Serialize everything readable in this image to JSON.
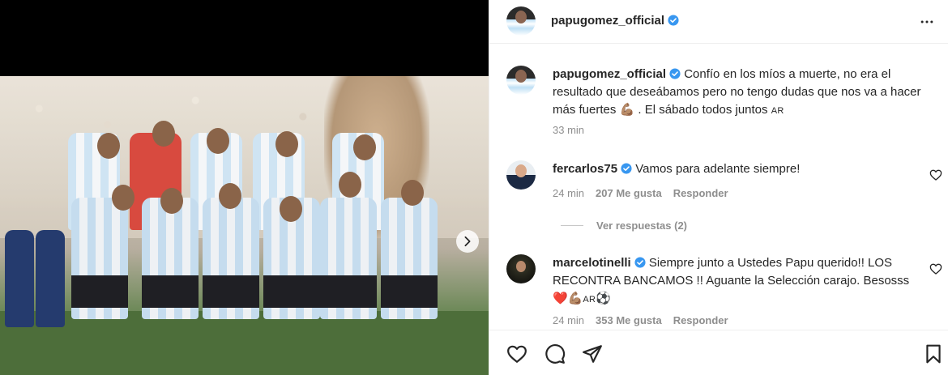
{
  "post": {
    "username": "papugomez_official",
    "icons": {
      "verified": "verified-badge-icon",
      "more": "more-options-icon",
      "next": "carousel-next-icon"
    }
  },
  "caption": {
    "username": "papugomez_official",
    "text_part1": "Confío en los míos a muerte, no era el resultado que deseábamos pero no tengo dudas que nos va a hacer más fuertes",
    "emoji_flex": "💪🏽",
    "text_part2": ". El sábado todos juntos",
    "flag": "AR",
    "time": "33 min"
  },
  "comments": [
    {
      "username": "fercarlos75",
      "text": "Vamos para adelante siempre!",
      "time": "24 min",
      "likes": "207 Me gusta",
      "reply_label": "Responder",
      "view_replies": "Ver respuestas (2)"
    },
    {
      "username": "marcelotinelli",
      "text": "Siempre junto a Ustedes Papu querido!! LOS RECONTRA BANCAMOS !! Aguante la Selección carajo. Besosss",
      "emoji_heart": "❤️",
      "emoji_flex": "💪🏽",
      "flag": "AR",
      "emoji_ball": "⚽",
      "time": "24 min",
      "likes": "353 Me gusta",
      "reply_label": "Responder"
    }
  ],
  "colors": {
    "verified": "#3897f0",
    "text": "#262626",
    "muted": "#8e8e8e"
  }
}
